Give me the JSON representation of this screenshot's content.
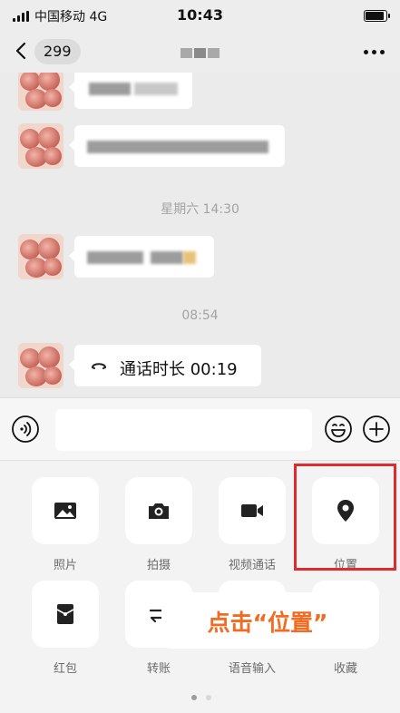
{
  "status_bar": {
    "carrier": "中国移动 4G",
    "time": "10:43",
    "battery_level": 0.9
  },
  "nav": {
    "unread_count": "299",
    "more_label": "···"
  },
  "chat": {
    "timestamps": [
      "星期六 14:30",
      "08:54"
    ],
    "call_message": "通话时长 00:19"
  },
  "input": {
    "placeholder": ""
  },
  "panel": {
    "tiles": [
      {
        "label": "照片",
        "icon": "photo-icon"
      },
      {
        "label": "拍摄",
        "icon": "camera-icon"
      },
      {
        "label": "视频通话",
        "icon": "video-call-icon"
      },
      {
        "label": "位置",
        "icon": "location-pin-icon"
      },
      {
        "label": "红包",
        "icon": "red-packet-icon"
      },
      {
        "label": "转账",
        "icon": "transfer-icon"
      },
      {
        "label": "语音输入",
        "icon": "microphone-icon"
      },
      {
        "label": "收藏",
        "icon": "favorites-icon"
      }
    ],
    "page_index": 1,
    "page_count": 2
  },
  "annotation": {
    "text": "点击“位置”",
    "highlight_color": "#e12a2e",
    "text_color": "#f26b21"
  }
}
